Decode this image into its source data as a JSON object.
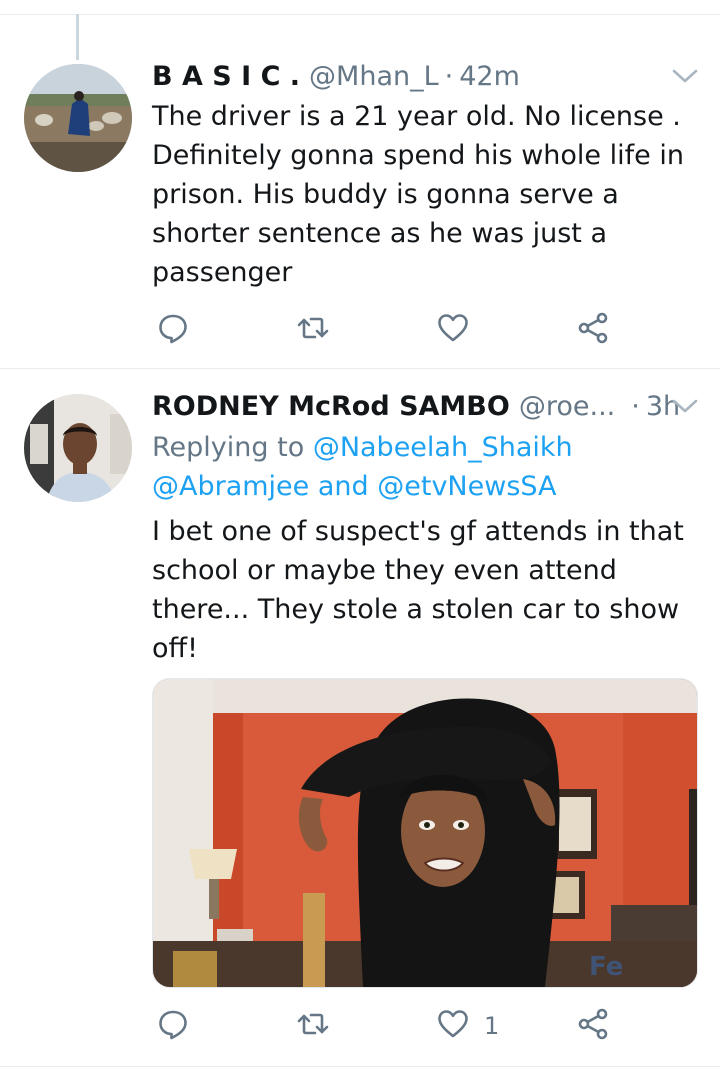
{
  "tweets": [
    {
      "name": "B A S I C .",
      "handle": "@Mhan_L",
      "separator": "·",
      "time": "42m",
      "text": "The driver is a 21 year old. No license . Definitely gonna spend his whole life in prison. His buddy is gonna serve a shorter sentence as he was just a passenger",
      "likes": ""
    },
    {
      "name": "RODNEY McRod SAMBO",
      "handle": "@roe...",
      "separator": "·",
      "time": "3h",
      "replying_prefix": "Replying to ",
      "reply_mention_1": "@Nabeelah_Shaikh",
      "reply_mention_2": "@Abramjee",
      "reply_and": " and ",
      "reply_mention_3": "@etvNewsSA",
      "text": "I bet one of suspect's gf attends in that school or maybe they even attend there... They stole a stolen car to show off!",
      "likes": "1"
    }
  ],
  "icons": {
    "reply": "reply-icon",
    "retweet": "retweet-icon",
    "like": "heart-icon",
    "share": "share-icon",
    "menu": "chevron-down-icon"
  },
  "colors": {
    "link": "#1da1f2",
    "secondary_text": "#657786",
    "divider": "#e6ecf0"
  }
}
